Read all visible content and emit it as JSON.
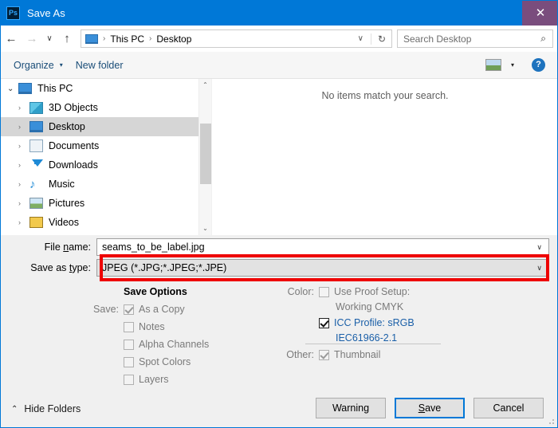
{
  "window": {
    "app_icon": "photoshop-ps-icon",
    "title": "Save As",
    "close_label": "✕"
  },
  "navigation": {
    "back_icon": "←",
    "forward_icon": "→",
    "recent_icon": "∨",
    "up_icon": "↑",
    "breadcrumb": [
      "This PC",
      "Desktop"
    ],
    "separator": "›",
    "dropdown_icon": "∨",
    "refresh_icon": "↻"
  },
  "search": {
    "placeholder": "Search Desktop",
    "icon": "⌕"
  },
  "commandbar": {
    "organize_label": "Organize",
    "organize_caret": "▾",
    "new_folder_label": "New folder",
    "view_caret": "▾",
    "help_label": "?"
  },
  "tree": {
    "items": [
      {
        "label": "This PC",
        "arrow": "⌄",
        "expanded": true,
        "selected": false,
        "icon": "pc-icon",
        "indent": 0
      },
      {
        "label": "3D Objects",
        "arrow": "›",
        "expanded": false,
        "selected": false,
        "icon": "3d-objects-icon",
        "indent": 1
      },
      {
        "label": "Desktop",
        "arrow": "›",
        "expanded": false,
        "selected": true,
        "icon": "desktop-icon",
        "indent": 1
      },
      {
        "label": "Documents",
        "arrow": "›",
        "expanded": false,
        "selected": false,
        "icon": "documents-icon",
        "indent": 1
      },
      {
        "label": "Downloads",
        "arrow": "›",
        "expanded": false,
        "selected": false,
        "icon": "downloads-icon",
        "indent": 1
      },
      {
        "label": "Music",
        "arrow": "›",
        "expanded": false,
        "selected": false,
        "icon": "music-icon",
        "indent": 1
      },
      {
        "label": "Pictures",
        "arrow": "›",
        "expanded": false,
        "selected": false,
        "icon": "pictures-icon",
        "indent": 1
      },
      {
        "label": "Videos",
        "arrow": "›",
        "expanded": false,
        "selected": false,
        "icon": "videos-icon",
        "indent": 1
      }
    ],
    "scroll_up_icon": "⌃",
    "scroll_down_icon": "⌄"
  },
  "filelist": {
    "empty_message": "No items match your search."
  },
  "fields": {
    "filename_label": "File name:",
    "filename_value": "seams_to_be_label.jpg",
    "filetype_label": "Save as type:",
    "filetype_value": "JPEG (*.JPG;*.JPEG;*.JPE)",
    "caret": "∨"
  },
  "highlight": {
    "color": "#ee0000",
    "target": "save-as-type-combobox"
  },
  "save_options": {
    "title": "Save Options",
    "save_prefix": "Save:",
    "items": [
      {
        "label": "As a Copy",
        "checked": true,
        "enabled": false
      },
      {
        "label": "Notes",
        "checked": false,
        "enabled": false
      },
      {
        "label": "Alpha Channels",
        "checked": false,
        "enabled": false
      },
      {
        "label": "Spot Colors",
        "checked": false,
        "enabled": false
      },
      {
        "label": "Layers",
        "checked": false,
        "enabled": false
      }
    ]
  },
  "color_options": {
    "color_prefix": "Color:",
    "proof_setup_label": "Use Proof Setup:",
    "proof_setup_sub": "Working CMYK",
    "proof_setup_checked": false,
    "icc_profile_label": "ICC Profile:  sRGB",
    "icc_profile_sub": "IEC61966-2.1",
    "icc_profile_checked": true,
    "other_prefix": "Other:",
    "thumbnail_label": "Thumbnail",
    "thumbnail_checked": true
  },
  "footer": {
    "hide_folders_label": "Hide Folders",
    "hide_folders_caret": "⌃",
    "warning_label": "Warning",
    "save_label": "Save",
    "cancel_label": "Cancel"
  }
}
